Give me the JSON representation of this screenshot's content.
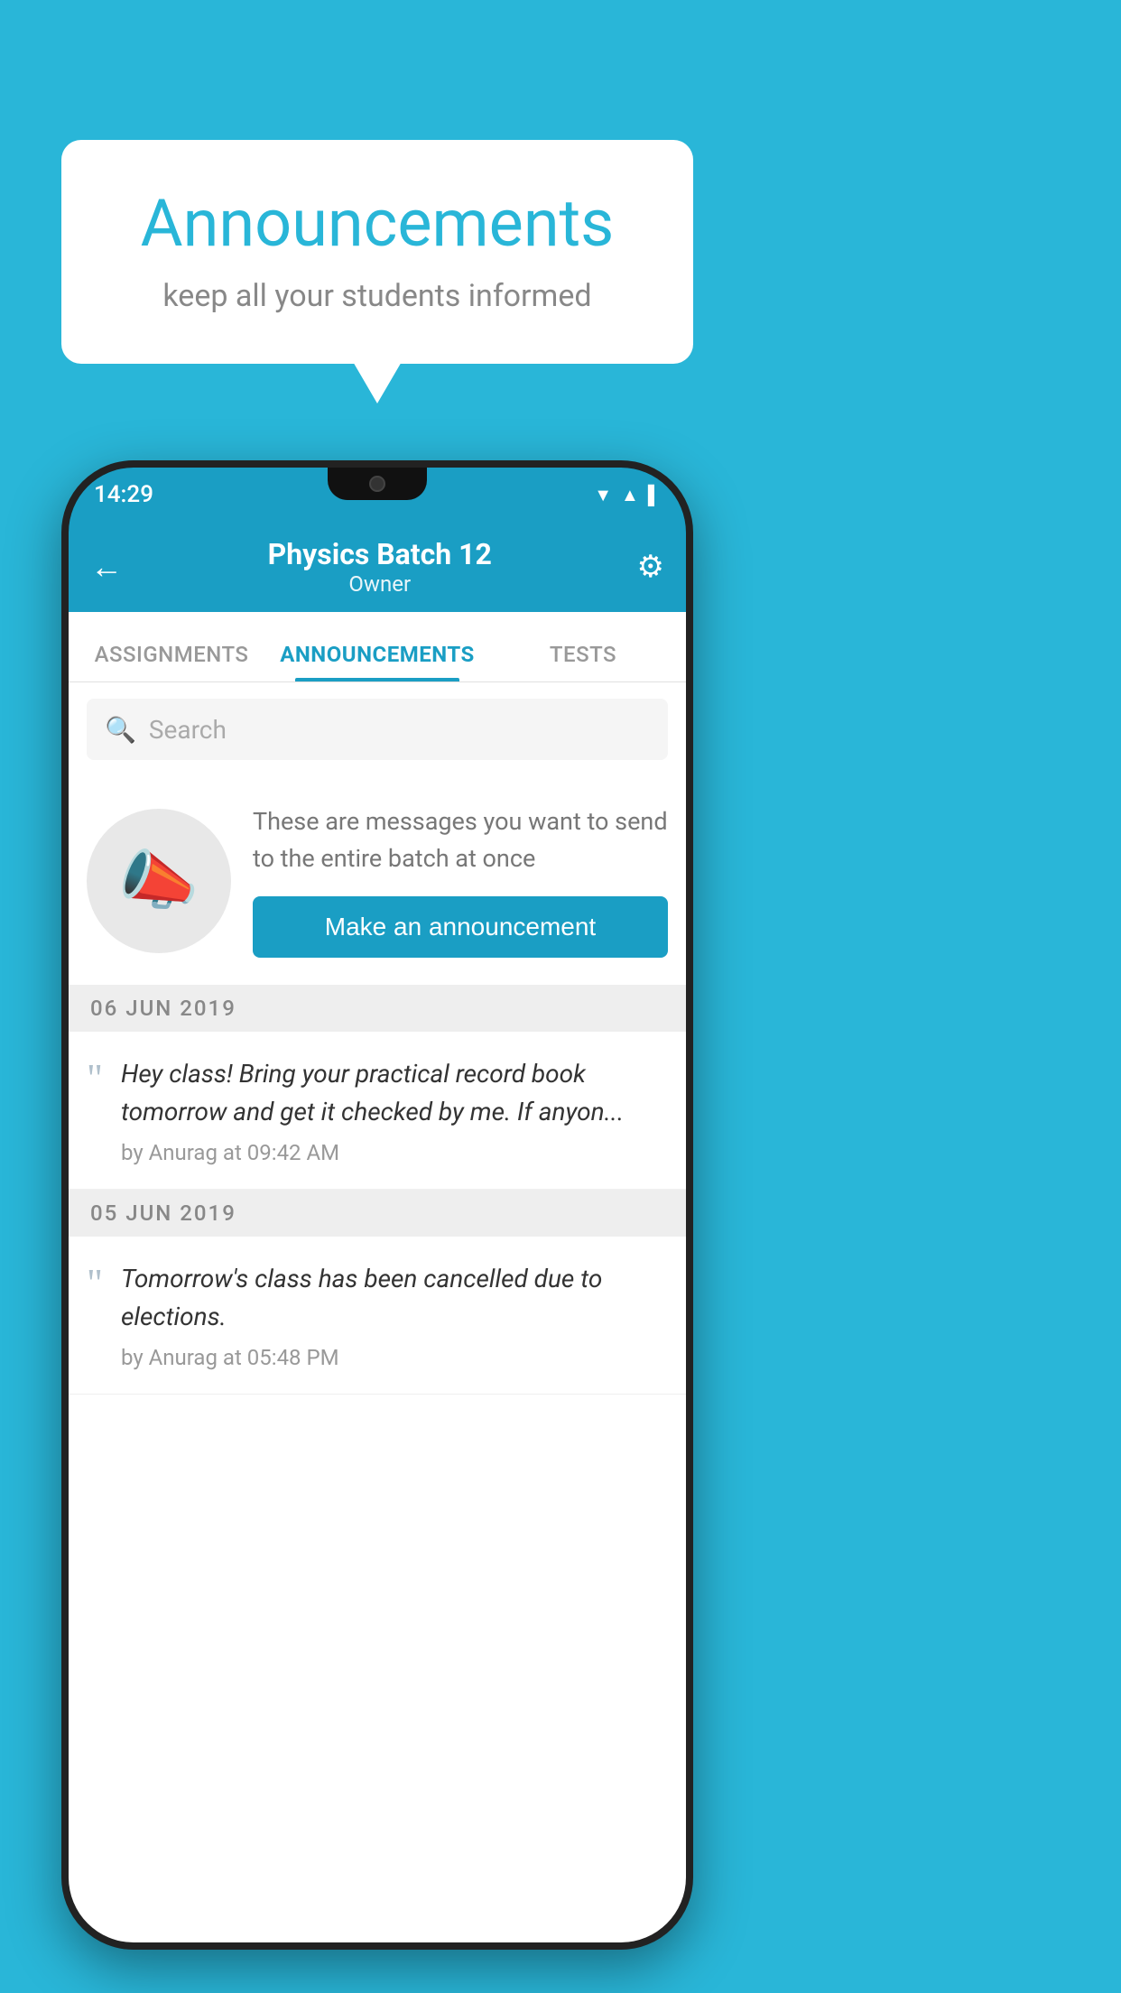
{
  "background_color": "#29b6d8",
  "speech_bubble": {
    "title": "Announcements",
    "subtitle": "keep all your students informed"
  },
  "phone": {
    "status_bar": {
      "time": "14:29",
      "wifi_icon": "▲",
      "signal_icon": "▲",
      "battery_icon": "▌"
    },
    "app_bar": {
      "back_label": "←",
      "title": "Physics Batch 12",
      "subtitle": "Owner",
      "settings_label": "⚙"
    },
    "tabs": [
      {
        "label": "ASSIGNMENTS",
        "active": false
      },
      {
        "label": "ANNOUNCEMENTS",
        "active": true
      },
      {
        "label": "TESTS",
        "active": false
      }
    ],
    "search": {
      "placeholder": "Search"
    },
    "promo": {
      "description": "These are messages you want to send to the entire batch at once",
      "button_label": "Make an announcement"
    },
    "announcements": [
      {
        "date": "06  JUN  2019",
        "text": "Hey class! Bring your practical record book tomorrow and get it checked by me. If anyon...",
        "meta": "by Anurag at 09:42 AM"
      },
      {
        "date": "05  JUN  2019",
        "text": "Tomorrow's class has been cancelled due to elections.",
        "meta": "by Anurag at 05:48 PM"
      }
    ]
  }
}
